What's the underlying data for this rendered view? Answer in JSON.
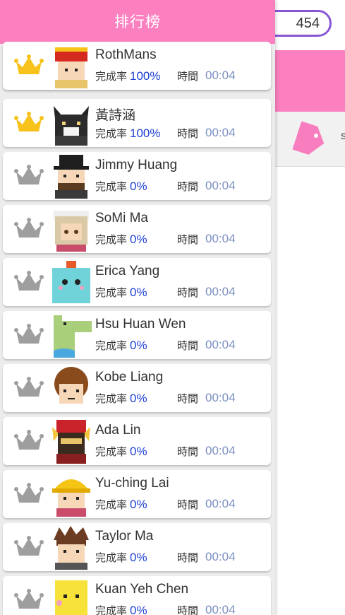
{
  "header": {
    "title": "排行榜"
  },
  "background": {
    "score": "454"
  },
  "labels": {
    "completion": "完成率",
    "time": "時間"
  },
  "colors": {
    "brand_pink": "#fc7fc0",
    "gold": "#f7c21a",
    "silver": "#9e9e9e",
    "percent_blue": "#1d3fd4",
    "time_blue": "#7b8fc2"
  },
  "players": [
    {
      "name": "RothMans",
      "percent": "100%",
      "time": "00:04",
      "crown": "gold",
      "avatar": "king-avatar"
    },
    {
      "name": "黃詩涵",
      "percent": "100%",
      "time": "00:04",
      "crown": "gold",
      "avatar": "cat-avatar"
    },
    {
      "name": "Jimmy Huang",
      "percent": "0%",
      "time": "00:04",
      "crown": "silver",
      "avatar": "tophat-avatar"
    },
    {
      "name": "SoMi Ma",
      "percent": "0%",
      "time": "00:04",
      "crown": "silver",
      "avatar": "maid-avatar"
    },
    {
      "name": "Erica Yang",
      "percent": "0%",
      "time": "00:04",
      "crown": "silver",
      "avatar": "monster-avatar"
    },
    {
      "name": "Hsu Huan Wen",
      "percent": "0%",
      "time": "00:04",
      "crown": "silver",
      "avatar": "croc-avatar"
    },
    {
      "name": "Kobe Liang",
      "percent": "0%",
      "time": "00:04",
      "crown": "silver",
      "avatar": "curly-avatar"
    },
    {
      "name": "Ada Lin",
      "percent": "0%",
      "time": "00:04",
      "crown": "silver",
      "avatar": "warrior-avatar"
    },
    {
      "name": "Yu-ching Lai",
      "percent": "0%",
      "time": "00:04",
      "crown": "silver",
      "avatar": "helmet-avatar"
    },
    {
      "name": "Taylor Ma",
      "percent": "0%",
      "time": "00:04",
      "crown": "silver",
      "avatar": "spiky-avatar"
    },
    {
      "name": "Kuan Yeh Chen",
      "percent": "0%",
      "time": "00:04",
      "crown": "silver",
      "avatar": "yellow-avatar"
    }
  ]
}
